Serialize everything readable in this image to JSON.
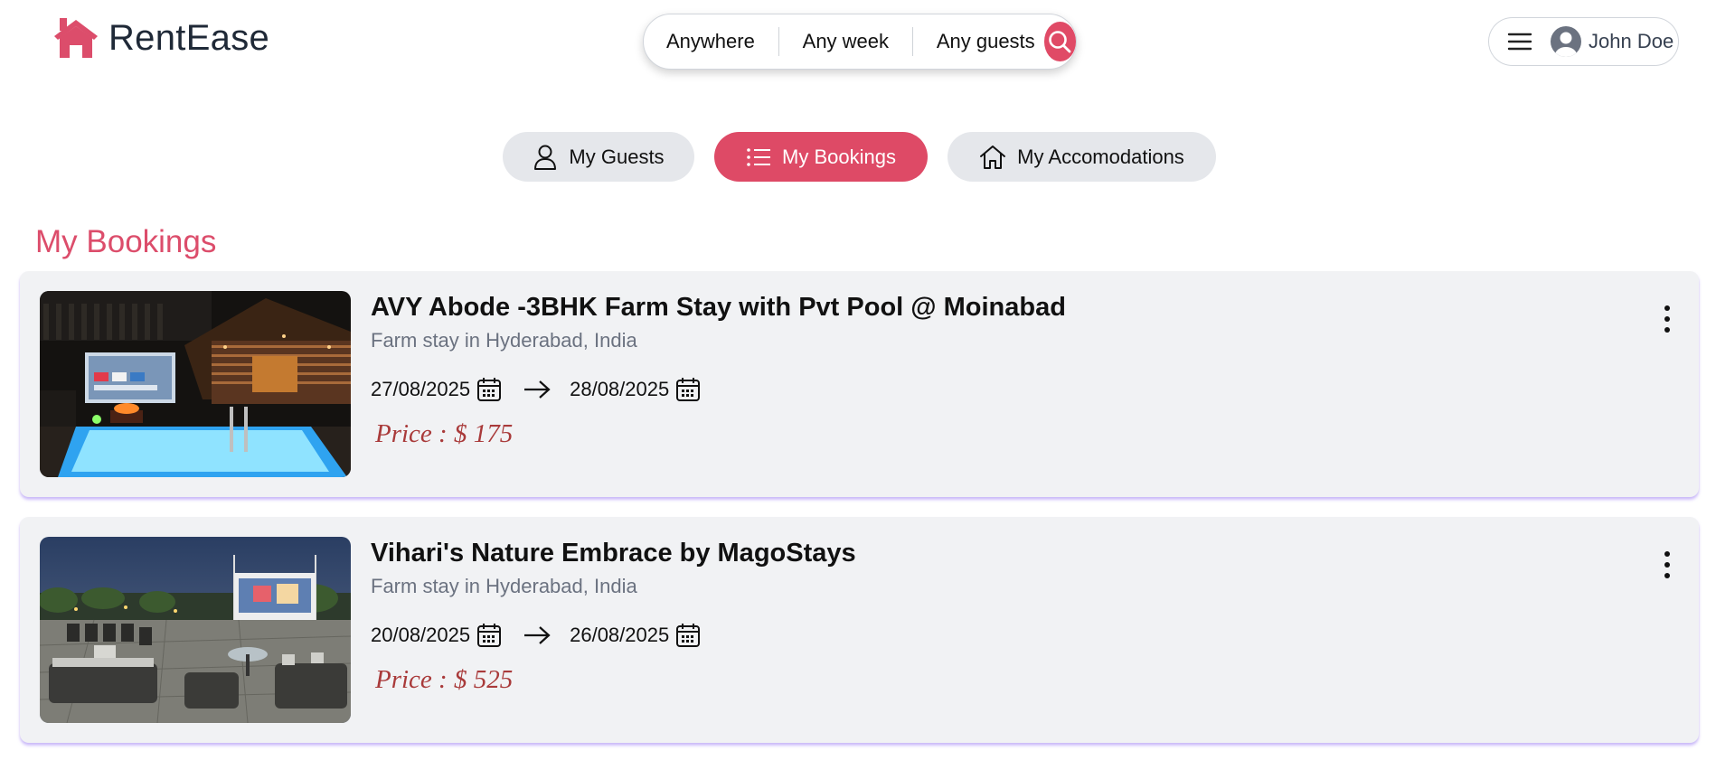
{
  "app": {
    "name": "RentEase",
    "logo_icon": "house-icon",
    "accent_color": "#e04a66"
  },
  "search": {
    "where": "Anywhere",
    "when": "Any week",
    "who": "Any guests",
    "button_icon": "search-icon"
  },
  "user": {
    "name": "John Doe",
    "menu_icon": "hamburger-icon",
    "avatar_icon": "user-avatar-icon"
  },
  "tabs": [
    {
      "label": "My Guests",
      "icon": "user-icon",
      "active": false
    },
    {
      "label": "My Bookings",
      "icon": "list-icon",
      "active": true
    },
    {
      "label": "My Accomodations",
      "icon": "home-icon",
      "active": false
    }
  ],
  "section_title": "My Bookings",
  "bookings": [
    {
      "title": "AVY Abode -3BHK Farm Stay with Pvt Pool @ Moinabad",
      "subtitle": "Farm stay in Hyderabad, India",
      "check_in": "27/08/2025",
      "check_out": "28/08/2025",
      "price": "Price : $ 175"
    },
    {
      "title": "Vihari's Nature Embrace by MagoStays",
      "subtitle": "Farm stay in Hyderabad, India",
      "check_in": "20/08/2025",
      "check_out": "26/08/2025",
      "price": "Price : $ 525"
    }
  ]
}
